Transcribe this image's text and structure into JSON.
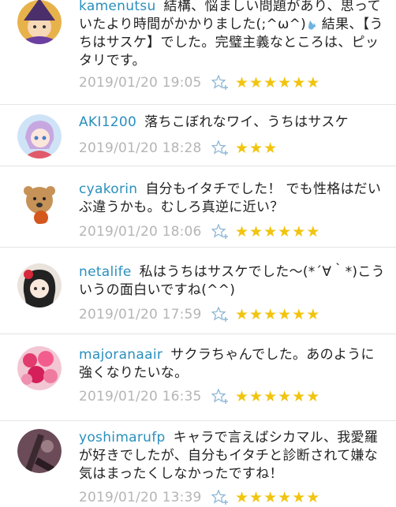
{
  "comments": [
    {
      "user": "kamenutsu",
      "text_a": "結構、悩ましい問題があり、思っていたより時間がかかりました(;^ω^)",
      "text_b": " 結果、【うちはサスケ】でした。完璧主義なところは、ピッタリです。",
      "date": "2019/01/20 19:05",
      "rating": 6
    },
    {
      "user": "AKI1200",
      "text": "落ちこぼれなワイ、うちはサスケ",
      "date": "2019/01/20 18:28",
      "rating": 3
    },
    {
      "user": "cyakorin",
      "text": "自分もイタチでした！ でも性格はだいぶ違うかも。むしろ真逆に近い？",
      "date": "2019/01/20 18:06",
      "rating": 6
    },
    {
      "user": "netalife",
      "text": "私はうちはサスケでした〜(*´∀｀*)こういうの面白いですね(^^)",
      "date": "2019/01/20 17:59",
      "rating": 6
    },
    {
      "user": "majoranaair",
      "text": "サクラちゃんでした。あのように強くなりたいな。",
      "date": "2019/01/20 16:35",
      "rating": 6
    },
    {
      "user": "yoshimarufp",
      "text": "キャラで言えばシカマル、我愛羅が好きでしたが、自分もイタチと診断されて嫌な気はまったくしなかったですね！",
      "date": "2019/01/20 13:39",
      "rating": 6
    }
  ],
  "icons": {
    "favorite": "star-plus-icon",
    "rating_star": "star-icon",
    "emoji": "sweat-drop-icon"
  },
  "colors": {
    "username": "#2a8fbd",
    "date": "#b5b5b5",
    "star": "#f1c40f",
    "favorite_icon": "#8fb8d6"
  }
}
